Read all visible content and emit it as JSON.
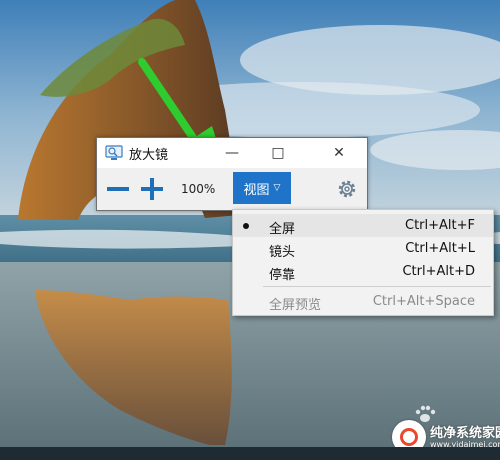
{
  "window": {
    "title": "放大镜",
    "minimize_symbol": "—",
    "maximize_symbol": "□",
    "close_symbol": "✕"
  },
  "toolbar": {
    "zoom_out_icon": "minus-icon",
    "zoom_in_icon": "plus-icon",
    "zoom_level": "100%",
    "view_label": "视图",
    "view_chevron": "▽",
    "settings_icon": "gear-icon"
  },
  "view_menu": {
    "items": [
      {
        "label": "全屏",
        "shortcut": "Ctrl+Alt+F",
        "selected": true,
        "enabled": true
      },
      {
        "label": "镜头",
        "shortcut": "Ctrl+Alt+L",
        "selected": false,
        "enabled": true
      },
      {
        "label": "停靠",
        "shortcut": "Ctrl+Alt+D",
        "selected": false,
        "enabled": true
      },
      {
        "label": "全屏预览",
        "shortcut": "Ctrl+Alt+Space",
        "selected": false,
        "enabled": false
      }
    ]
  },
  "watermark": {
    "text": "纯净系统家园",
    "url": "www.yidaimei.com"
  },
  "colors": {
    "accent": "#1f73c8",
    "arrow": "#2ecc2e",
    "menu_bg": "#f2f2f2",
    "toolbar_icon": "#1f6fb8"
  }
}
